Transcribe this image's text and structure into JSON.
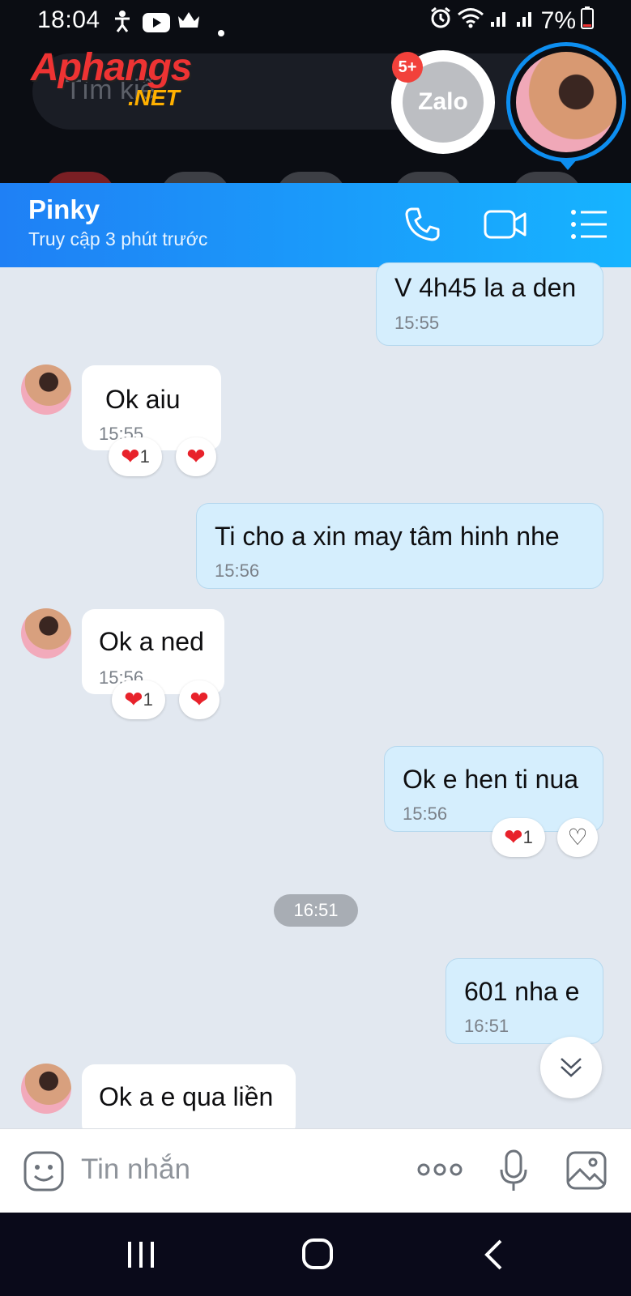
{
  "status_bar": {
    "time": "18:04",
    "battery": "7%",
    "left_icons": [
      "accessibility-icon",
      "youtube-icon",
      "crown-icon",
      "dot-icon"
    ],
    "right_icons": [
      "alarm-icon",
      "wifi-icon",
      "signal-icon",
      "signal-icon",
      "battery-icon"
    ]
  },
  "background": {
    "search_placeholder": "Tìm kiế",
    "watermark_line1": "Aphangs",
    "watermark_line2": ".NET",
    "zalo_label": "Zalo",
    "zalo_badge": "5+"
  },
  "header": {
    "contact_name": "Pinky",
    "last_seen": "Truy cập 3 phút trước",
    "icons": [
      "phone-icon",
      "video-call-icon",
      "menu-list-icon"
    ]
  },
  "messages": [
    {
      "direction": "out",
      "text": "V 4h45 la a den",
      "time": "15:55"
    },
    {
      "direction": "in",
      "text": "Ok aiu",
      "time": "15:55",
      "reactions": [
        {
          "emoji": "heart",
          "count": "1"
        },
        {
          "emoji": "heart",
          "count": ""
        }
      ]
    },
    {
      "direction": "out",
      "text": "Ti cho a xin may tâm hinh nhe",
      "time": "15:56"
    },
    {
      "direction": "in",
      "text": "Ok a ned",
      "time": "15:56",
      "reactions": [
        {
          "emoji": "heart",
          "count": "1"
        },
        {
          "emoji": "heart",
          "count": ""
        }
      ]
    },
    {
      "direction": "out",
      "text": "Ok e hen ti nua",
      "time": "15:56",
      "reactions": [
        {
          "emoji": "heart",
          "count": "1"
        },
        {
          "emoji": "heart-outline",
          "count": ""
        }
      ]
    },
    {
      "direction": "out",
      "text": "601 nha e",
      "time": "16:51"
    },
    {
      "direction": "in",
      "text": "Ok a e qua liền",
      "time": ""
    }
  ],
  "time_divider": "16:51",
  "composer": {
    "placeholder": "Tin nhắn",
    "icons": [
      "emoji-icon",
      "more-icon",
      "microphone-icon",
      "image-icon"
    ]
  },
  "nav_bar": {
    "icons": [
      "recent-apps-icon",
      "home-icon",
      "back-icon"
    ]
  },
  "colors": {
    "header_gradient_start": "#1f80f5",
    "header_gradient_end": "#16b4ff",
    "outgoing_bubble": "#d5eefd",
    "chat_background": "#e2e8f0",
    "heart": "#e8222b"
  }
}
